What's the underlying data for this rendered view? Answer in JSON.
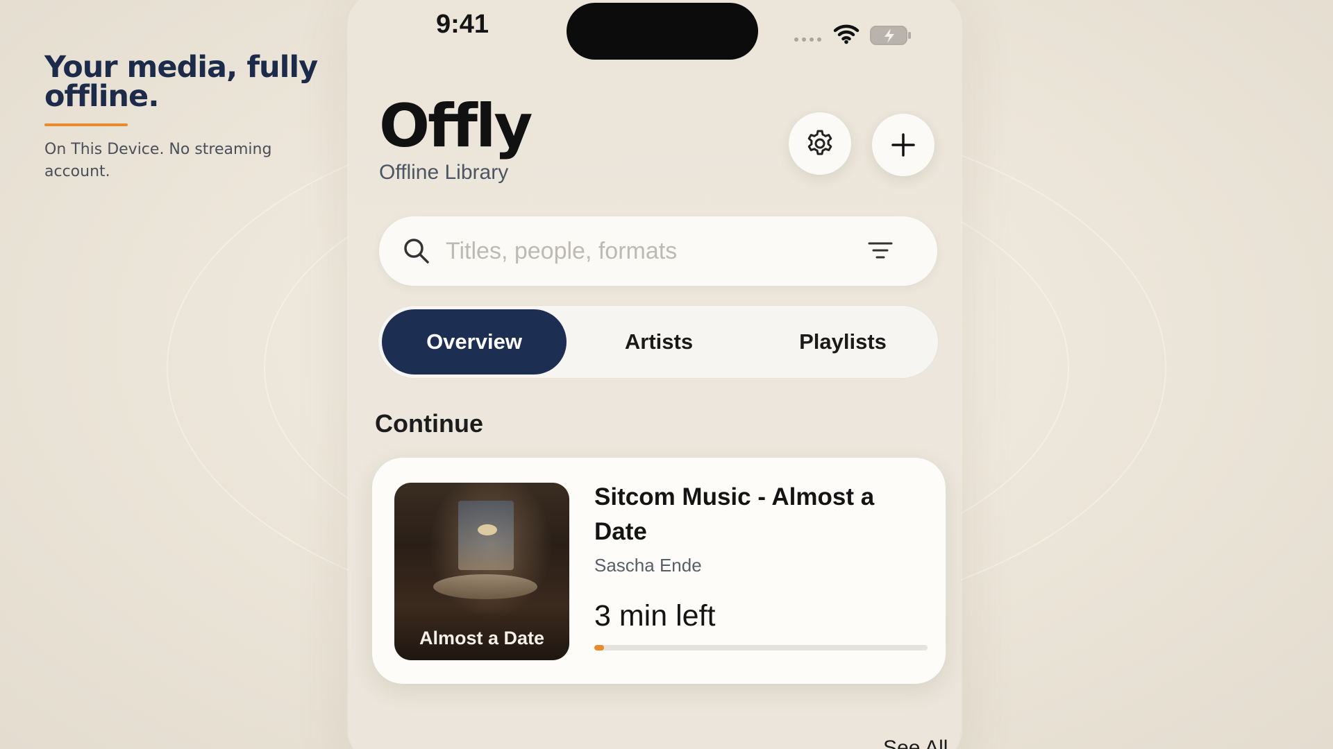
{
  "promo": {
    "title": "Your media, fully offline.",
    "subtitle": "On This Device. No streaming account.",
    "accent_color": "#e88a2e"
  },
  "status_bar": {
    "time": "9:41",
    "icons": [
      "signal-dots-icon",
      "wifi-icon",
      "battery-charging-icon"
    ]
  },
  "header": {
    "title": "Offly",
    "subtitle": "Offline Library",
    "settings_icon": "gear-icon",
    "add_icon": "plus-icon"
  },
  "search": {
    "placeholder": "Titles, people, formats",
    "value": "",
    "filter_icon": "filter-lines-icon"
  },
  "tabs": {
    "items": [
      {
        "label": "Overview",
        "selected": true
      },
      {
        "label": "Artists",
        "selected": false
      },
      {
        "label": "Playlists",
        "selected": false
      }
    ],
    "selected_color": "#1c2e52"
  },
  "continue": {
    "section_title": "Continue",
    "item": {
      "artwork_caption": "Almost a Date",
      "title": "Sitcom Music - Almost a Date",
      "artist": "Sascha Ende",
      "time_left": "3 min left",
      "progress": 0.03,
      "progress_color": "#e88a2e"
    }
  },
  "next_section": {
    "see_all_label": "See All"
  }
}
